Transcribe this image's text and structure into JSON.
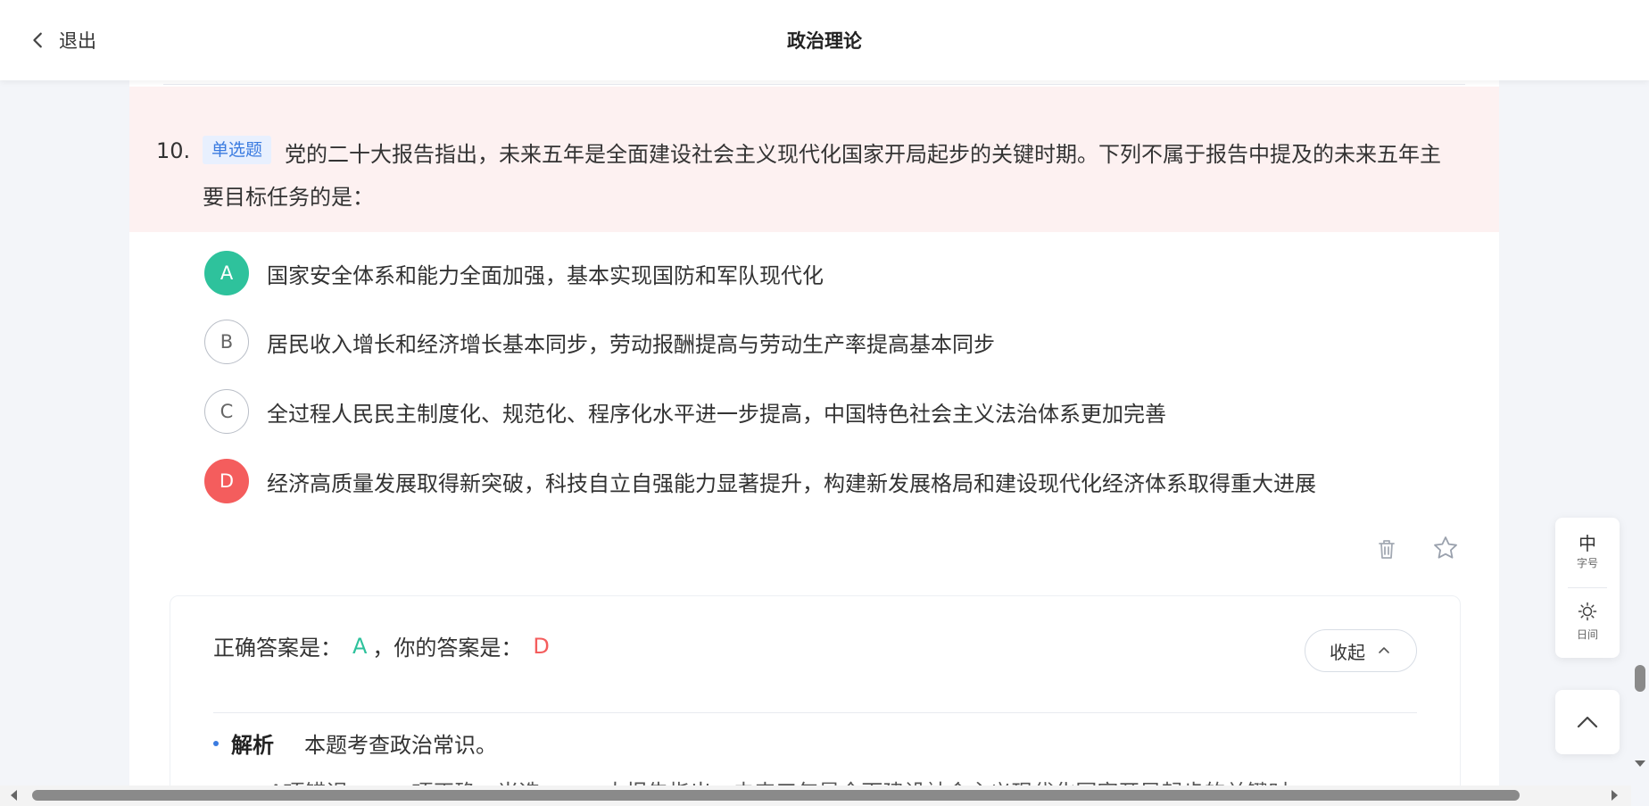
{
  "header": {
    "back_label": "退出",
    "title": "政治理论"
  },
  "question": {
    "number": "10.",
    "type": "单选题",
    "text": "党的二十大报告指出，未来五年是全面建设社会主义现代化国家开局起步的关键时期。下列不属于报告中提及的未来五年主要目标任务的是：",
    "options": [
      {
        "letter": "A",
        "text": "国家安全体系和能力全面加强，基本实现国防和军队现代化",
        "state": "correct"
      },
      {
        "letter": "B",
        "text": "居民收入增长和经济增长基本同步，劳动报酬提高与劳动生产率提高基本同步",
        "state": "normal"
      },
      {
        "letter": "C",
        "text": "全过程人民民主制度化、规范化、程序化水平进一步提高，中国特色社会主义法治体系更加完善",
        "state": "normal"
      },
      {
        "letter": "D",
        "text": "经济高质量发展取得新突破，科技自立自强能力显著提升，构建新发展格局和建设现代化经济体系取得重大进展",
        "state": "wrong"
      }
    ]
  },
  "answer": {
    "correct_label": "正确答案是：",
    "correct_value": "A",
    "separator": "，",
    "your_label": "你的答案是：",
    "your_value": "D",
    "collapse_label": "收起",
    "analysis_title": "解析",
    "analysis_text": "本题考查政治常识。",
    "analysis_partial": "A项错误。……项正确，当选。……大报告指出，未来五年是全面建设社会主义现代化国家开局起步的关键时"
  },
  "tools": {
    "font_size_value": "中",
    "font_size_label": "字号",
    "theme_label": "日间"
  },
  "colors": {
    "correct": "#2ec29c",
    "wrong": "#f45d5d",
    "tag_blue": "#3a7be0",
    "question_bg": "#fdf1f1"
  }
}
